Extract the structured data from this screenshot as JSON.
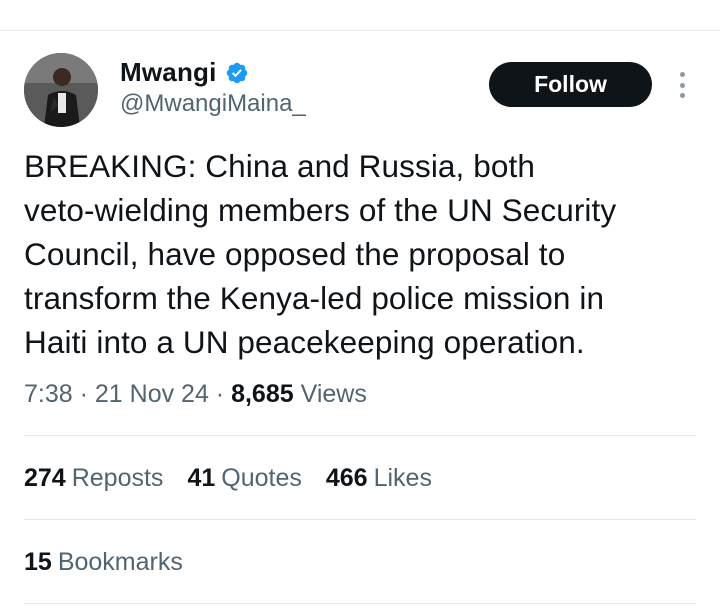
{
  "author": {
    "display_name": "Mwangi",
    "handle": "@MwangiMaina_",
    "verified_icon": "verified-badge-icon",
    "badge_color": "#1d9bf0"
  },
  "actions": {
    "follow_label": "Follow",
    "more_icon": "more-vertical-icon"
  },
  "tweet": {
    "text": "BREAKING: China and Russia, both\nveto-wielding members of the UN Security\nCouncil, have opposed the proposal to\ntransform the Kenya-led police mission in\nHaiti into a UN peacekeeping operation."
  },
  "meta": {
    "time": "7:38",
    "sep1": " · ",
    "date": "21 Nov 24",
    "sep2": " · ",
    "views_count": "8,685",
    "views_label": "Views"
  },
  "stats": {
    "reposts_count": "274",
    "reposts_label": "Reposts",
    "quotes_count": "41",
    "quotes_label": "Quotes",
    "likes_count": "466",
    "likes_label": "Likes",
    "bookmarks_count": "15",
    "bookmarks_label": "Bookmarks"
  },
  "colors": {
    "text": "#0f1419",
    "secondary": "#536471",
    "button_bg": "#0f1419",
    "divider": "#e6e9ec"
  }
}
